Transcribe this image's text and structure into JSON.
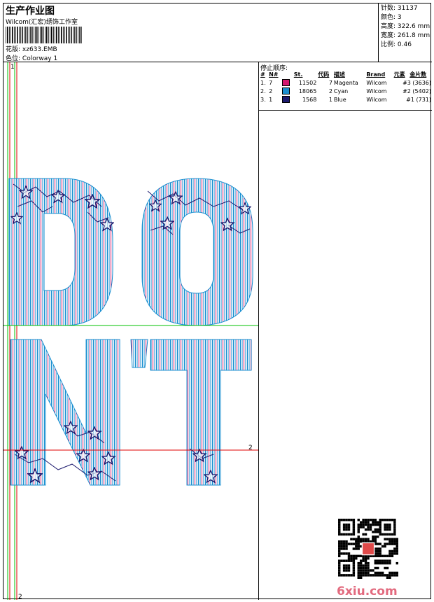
{
  "header": {
    "title": "生产作业图",
    "company": "Wilcom(汇宏)绣饰工作室",
    "pattern_label": "花版:",
    "pattern_value": "xz633.EMB",
    "colorway_label": "色位:",
    "colorway_value": "Colorway 1"
  },
  "specs": [
    {
      "label": "针数:",
      "value": "31137"
    },
    {
      "label": "颜色:",
      "value": "3"
    },
    {
      "label": "高度:",
      "value": "322.6 mm"
    },
    {
      "label": "宽度:",
      "value": "261.8 mm"
    },
    {
      "label": "比例:",
      "value": "0.46"
    }
  ],
  "stop_sequence": {
    "title": "停止顺序:",
    "columns": [
      "#",
      "N#",
      "St.",
      "代码",
      "描述",
      "Brand",
      "元素",
      "金片数"
    ],
    "rows": [
      {
        "n": "1.",
        "needle": "7",
        "color": "#d2186e",
        "stitches": "11502",
        "code": "7",
        "desc": "Magenta",
        "brand": "Wilcom",
        "chart": "#3 (3636)"
      },
      {
        "n": "2.",
        "needle": "2",
        "color": "#1a8fd0",
        "stitches": "18065",
        "code": "2",
        "desc": "Cyan",
        "brand": "Wilcom",
        "chart": "#2 (5402)"
      },
      {
        "n": "3.",
        "needle": "1",
        "color": "#1c1a6e",
        "stitches": "1568",
        "code": "1",
        "desc": "Blue",
        "brand": "Wilcom",
        "chart": "#1 (731)"
      }
    ]
  },
  "design": {
    "text": "DON'T",
    "guide_labels": [
      "1",
      "2",
      "2"
    ],
    "colors": {
      "magenta": "#d2186e",
      "cyan": "#1a8fd0",
      "blue": "#1c1a6e",
      "guide_red": "#e00000",
      "guide_green": "#00c000"
    }
  },
  "watermark": {
    "text": "6xiu.com"
  }
}
